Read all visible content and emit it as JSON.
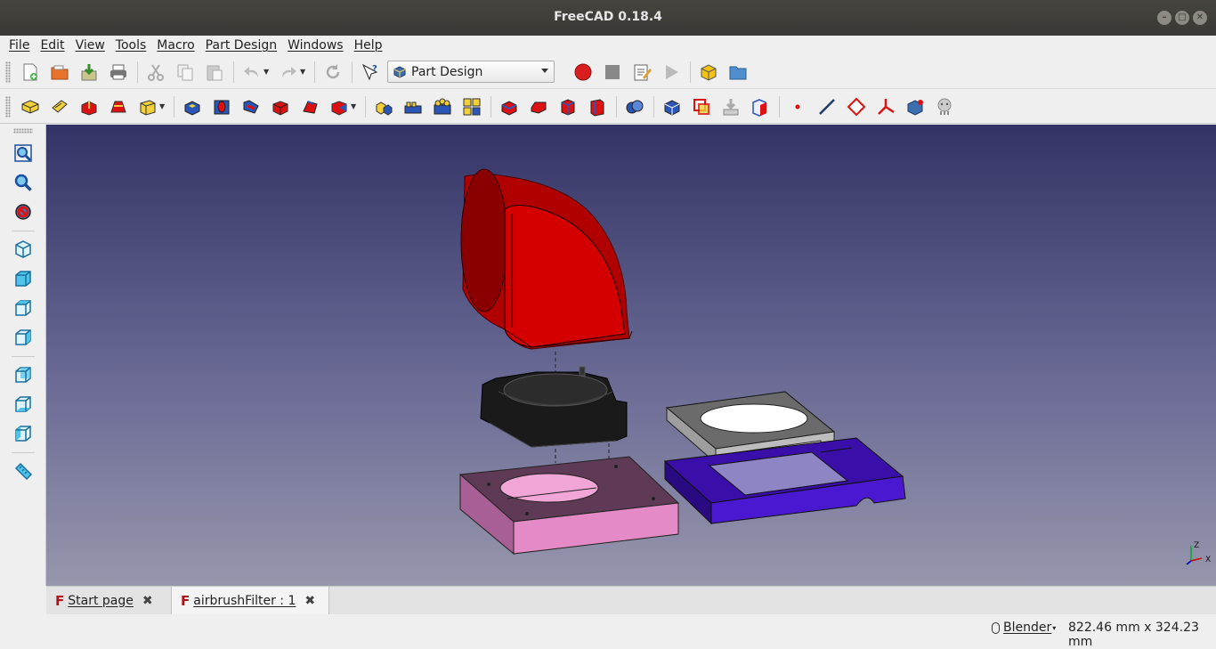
{
  "window": {
    "title": "FreeCAD 0.18.4"
  },
  "menubar": {
    "items": [
      "File",
      "Edit",
      "View",
      "Tools",
      "Macro",
      "Part Design",
      "Windows",
      "Help"
    ]
  },
  "toolbar": {
    "workbench": "Part Design"
  },
  "tabs": [
    {
      "label": "Start page",
      "active": false
    },
    {
      "label": "airbrushFilter : 1",
      "active": true
    }
  ],
  "status": {
    "navigation": "Blender",
    "dimensions": "822.46 mm x 324.23 mm"
  },
  "axis_indicator": {
    "z": "Z",
    "x": "X"
  },
  "colors": {
    "viewport_top": "#333366",
    "viewport_bottom": "#9696ad",
    "part_red": "#d00000",
    "part_black": "#1c1c1c",
    "part_pink": "#e48ac6",
    "part_white": "#f2f2f2",
    "part_blue": "#4a18d0"
  }
}
